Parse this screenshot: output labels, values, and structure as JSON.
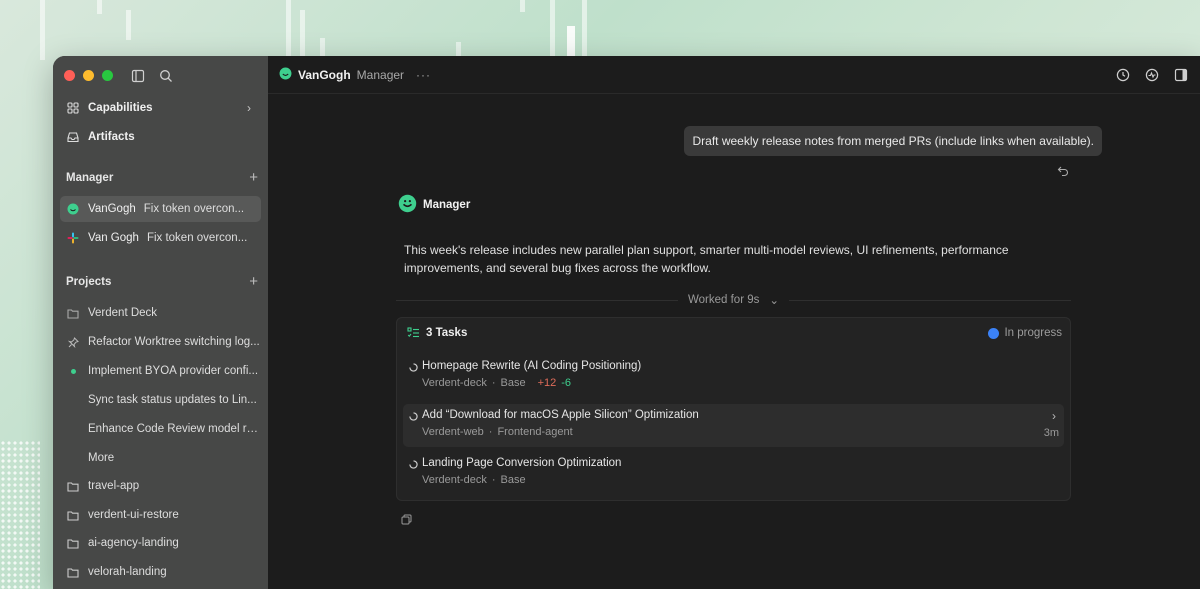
{
  "sidebar": {
    "nav": [
      {
        "label": "Capabilities",
        "icon": "grid-icon"
      },
      {
        "label": "Artifacts",
        "icon": "inbox-icon"
      }
    ],
    "manager_section": "Manager",
    "manager_items": [
      {
        "name": "VanGogh",
        "task": "Fix token overcon..."
      },
      {
        "name": "Van Gogh",
        "task": "Fix token overcon..."
      }
    ],
    "projects_section": "Projects",
    "projects": [
      {
        "label": "Verdent Deck",
        "icon": "folder-icon",
        "muted": true
      },
      {
        "label": "Refactor Worktree switching log...",
        "icon": "pin-icon"
      },
      {
        "label": "Implement BYOA provider confi...",
        "icon": "dot-icon"
      },
      {
        "label": "Sync task status updates to Lin...",
        "icon": ""
      },
      {
        "label": "Enhance Code Review model ro...",
        "icon": ""
      },
      {
        "label": "More",
        "icon": "",
        "muted": true
      },
      {
        "label": "travel-app",
        "icon": "folder-icon"
      },
      {
        "label": "verdent-ui-restore",
        "icon": "folder-icon"
      },
      {
        "label": "ai-agency-landing",
        "icon": "folder-icon"
      },
      {
        "label": "velorah-landing",
        "icon": "folder-icon"
      }
    ]
  },
  "topbar": {
    "agent_name": "VanGogh",
    "role": "Manager",
    "more": "···"
  },
  "chat": {
    "user_message": "Draft weekly release notes from merged PRs (include links when available).",
    "assistant_name": "Manager",
    "answer": "This week's release includes new parallel plan support, smarter multi-model reviews, UI refinements, performance improvements, and several bug fixes across the workflow.",
    "worked_for": "Worked for 9s"
  },
  "tasks": {
    "header": "3 Tasks",
    "status": "In progress",
    "items": [
      {
        "title": "Homepage Rewrite (AI Coding Positioning)",
        "project": "Verdent-deck",
        "branch": "Base",
        "added": "+12",
        "removed": "-6",
        "time": ""
      },
      {
        "title": "Add “Download for macOS Apple Silicon” Optimization",
        "project": "Verdent-web",
        "branch": "Frontend-agent",
        "added": "",
        "removed": "",
        "time": "3m"
      },
      {
        "title": "Landing Page Conversion Optimization",
        "project": "Verdent-deck",
        "branch": "Base",
        "added": "",
        "removed": "",
        "time": ""
      }
    ]
  },
  "colors": {
    "accent_green": "#3ecf8e",
    "status_blue": "#3b82f6",
    "diff_add": "#e06c5a",
    "diff_remove": "#3ecf8e"
  }
}
